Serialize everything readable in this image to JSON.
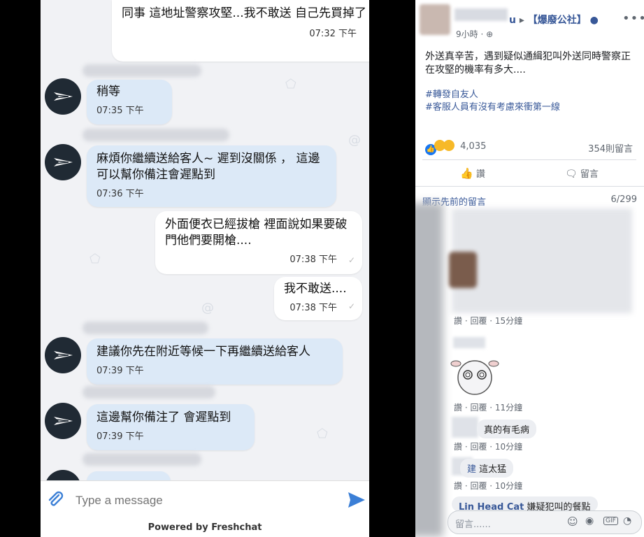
{
  "chat": {
    "messages": [
      {
        "side": "out",
        "text": "同事 這地址警察攻堅...我不敢送 自己先買掉了",
        "time": "07:32 下午"
      },
      {
        "side": "in",
        "text": "稍等",
        "time": "07:35 下午"
      },
      {
        "side": "in",
        "text": "麻煩你繼續送給客人~ 遲到沒關係 ， 這邊可以幫你備注會遲點到",
        "time": "07:36 下午"
      },
      {
        "side": "out",
        "text": "外面便衣已經拔槍 裡面說如果要破門他們要開槍....",
        "time": "07:38 下午"
      },
      {
        "side": "out",
        "text": "我不敢送....",
        "time": "07:38 下午"
      },
      {
        "side": "in",
        "text": "建議你先在附近等候一下再繼續送給客人",
        "time": "07:39 下午"
      },
      {
        "side": "in",
        "text": "這邊幫你備注了 會遲點到",
        "time": "07:39 下午"
      }
    ],
    "composer": {
      "placeholder": "Type a message"
    },
    "powered_by": "Powered by Freshchat"
  },
  "fb": {
    "page_name": "【爆廢公社】",
    "name_suffix": "u",
    "post_time": "9小時",
    "post_text": "外送真辛苦，遇到疑似通緝犯叫外送同時警察正在攻堅的機率有多大....",
    "hashtags": [
      "#轉發自友人",
      "#客服人員有沒有考慮來衝第一線"
    ],
    "reaction_count": "4,035",
    "comment_count": "354則留言",
    "like_label": "讚",
    "comment_label": "留言",
    "prev_comments": "顯示先前的留言",
    "comment_paging": "6/299",
    "comments": [
      {
        "text": "",
        "actions": "讚 · 回覆 · 15分鐘"
      },
      {
        "text": "",
        "actions": "讚 · 回覆 · 11分鐘"
      },
      {
        "text": "真的有毛病",
        "actions": "讚 · 回覆 · 10分鐘"
      },
      {
        "text": "這太猛",
        "prefix": "建",
        "actions": "讚 · 回覆 · 10分鐘"
      }
    ],
    "last_comment_name": "Lin Head Cat",
    "last_comment_text": "嫌疑犯叫的餐點",
    "comment_input_placeholder": "留言......"
  }
}
